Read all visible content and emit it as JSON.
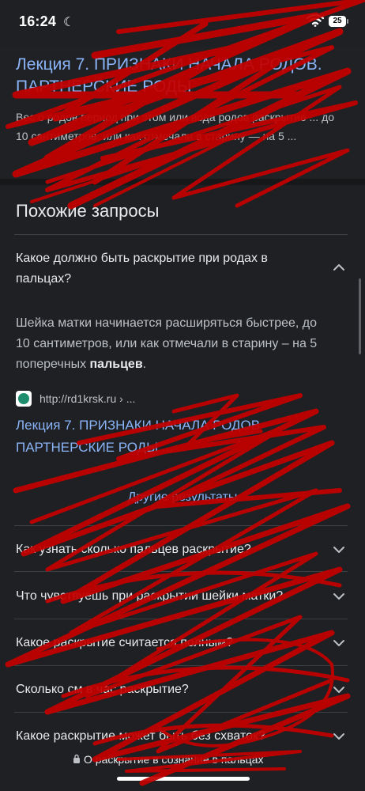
{
  "status_bar": {
    "time": "16:24",
    "battery": "25"
  },
  "top_result": {
    "title": "Лекция 7. ПРИЗНАКИ НАЧАЛА РОДОВ. ПАРТНЕРСКИЕ РОДЫ",
    "snippet": "Вес  о  родов  период  при этом или  вода  родов раскрытие ... до 10 сантиметров, или как отмечали в старину — на 5 ..."
  },
  "related": {
    "heading": "Похожие запросы",
    "expanded_question": "Какое должно быть раскрытие при родах в пальцах?",
    "answer_before_bold": "Шейка матки начинается расширяться быстрее, до 10 сантиметров, или как отмечали в старину – на 5 поперечных ",
    "answer_bold": "пальцев",
    "answer_after_bold": ".",
    "source_url": "http://rd1krsk.ru › ...",
    "source_title": "Лекция 7. ПРИЗНАКИ НАЧАЛА РОДОВ ПАРТНЕРСКИЕ РОДЫ ...",
    "other_results": "Другие результаты",
    "questions": [
      "Как узнать сколько пальцев раскрытие?",
      "Что чувствуешь при раскрытии шейки матки?",
      "Какое раскрытие считается полным?",
      "Сколько см в час раскрытие?",
      "Какое раскрытие может быть без схваток?"
    ]
  },
  "url_bar": {
    "text": "О раскрытие в сознание в пальцах"
  },
  "colors": {
    "link": "#8ab4f8",
    "background": "#1f2023",
    "scribble": "#c40000"
  },
  "icons": [
    "moon-icon",
    "wifi-icon",
    "chevron-up-icon",
    "chevron-down-icon",
    "lock-icon",
    "site-favicon-icon"
  ]
}
